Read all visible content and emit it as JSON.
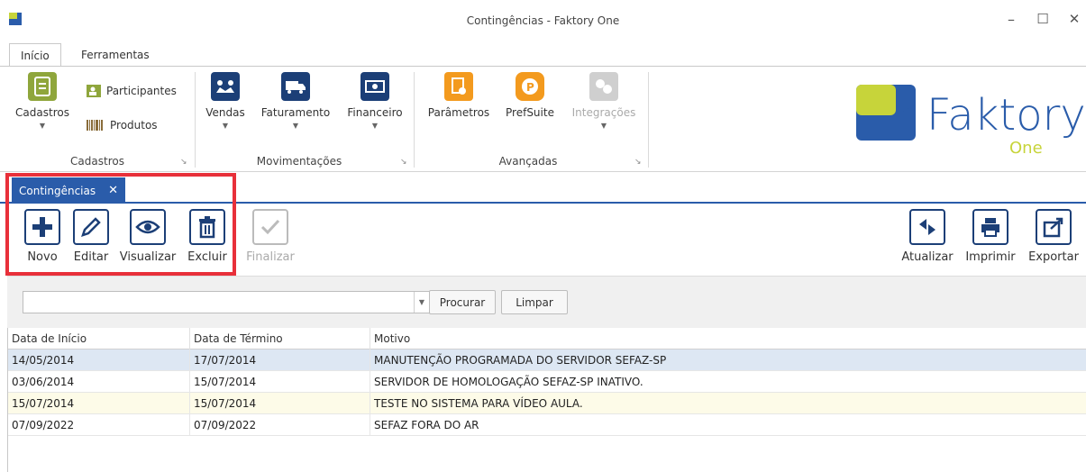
{
  "window": {
    "title": "Contingências - Faktory One",
    "minimize": "–",
    "maximize": "☐",
    "close": "✕"
  },
  "ribbon_tabs": [
    {
      "label": "Início"
    },
    {
      "label": "Ferramentas"
    }
  ],
  "ribbon": {
    "cadastros": {
      "big_label": "Cadastros",
      "participantes": "Participantes",
      "produtos": "Produtos",
      "group": "Cadastros"
    },
    "movimentacoes": {
      "vendas": "Vendas",
      "faturamento": "Faturamento",
      "financeiro": "Financeiro",
      "group": "Movimentações"
    },
    "avancadas": {
      "parametros": "Parâmetros",
      "prefsuite": "PrefSuite",
      "integracoes": "Integrações",
      "group": "Avançadas"
    },
    "launcher": "↘"
  },
  "logo": {
    "brand": "Faktory",
    "sub": "One"
  },
  "doc_tab": {
    "label": "Contingências",
    "close": "✕"
  },
  "toolbar": {
    "novo": "Novo",
    "editar": "Editar",
    "visualizar": "Visualizar",
    "excluir": "Excluir",
    "finalizar": "Finalizar",
    "atualizar": "Atualizar",
    "imprimir": "Imprimir",
    "exportar": "Exportar"
  },
  "search": {
    "value": "",
    "procurar": "Procurar",
    "limpar": "Limpar"
  },
  "table": {
    "columns": [
      "Data de Início",
      "Data de Término",
      "Motivo"
    ],
    "rows": [
      [
        "14/05/2014",
        "17/07/2014",
        "MANUTENÇÃO PROGRAMADA DO SERVIDOR SEFAZ-SP"
      ],
      [
        "03/06/2014",
        "15/07/2014",
        "SERVIDOR DE HOMOLOGAÇÃO SEFAZ-SP INATIVO."
      ],
      [
        "15/07/2014",
        "15/07/2014",
        "TESTE NO SISTEMA PARA VÍDEO AULA."
      ],
      [
        "07/09/2022",
        "07/09/2022",
        "SEFAZ FORA DO AR"
      ]
    ]
  },
  "colors": {
    "accent": "#2a5caa",
    "highlight": "#e8303a",
    "selected_row": "#dde7f3",
    "yellow_row": "#fdfbe8",
    "icon_navy": "#1c3f77",
    "icon_orange": "#f39a1e",
    "icon_olive": "#8fa63c",
    "logo_yellow": "#c7d43a",
    "logo_blue": "#2a5caa"
  }
}
